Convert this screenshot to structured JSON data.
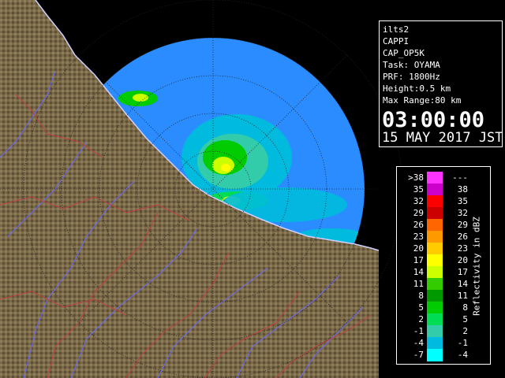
{
  "info": {
    "radar_name": "ilts2",
    "product": "CAPPI",
    "product_code": "CAP_OP5K",
    "task": "Task: OYAMA",
    "prf": "PRF: 1800Hz",
    "height": "Height:0.5 km",
    "max_range": "Max Range:80 km",
    "time": "03:00:00",
    "date": "15 MAY 2017 JST"
  },
  "legend": {
    "title": "Reflectivity in dBZ",
    "rows": [
      {
        "low": ">38",
        "high": "---",
        "color": "#ff33ff"
      },
      {
        "low": "35",
        "high": "38",
        "color": "#cc00cc"
      },
      {
        "low": "32",
        "high": "35",
        "color": "#ff0000"
      },
      {
        "low": "29",
        "high": "32",
        "color": "#cc0000"
      },
      {
        "low": "26",
        "high": "29",
        "color": "#ff6600"
      },
      {
        "low": "23",
        "high": "26",
        "color": "#ff9900"
      },
      {
        "low": "20",
        "high": "23",
        "color": "#ffcc00"
      },
      {
        "low": "17",
        "high": "20",
        "color": "#ffff00"
      },
      {
        "low": "14",
        "high": "17",
        "color": "#ccff00"
      },
      {
        "low": "11",
        "high": "14",
        "color": "#33cc00"
      },
      {
        "low": "8",
        "high": "11",
        "color": "#009900"
      },
      {
        "low": "5",
        "high": "8",
        "color": "#00cc00"
      },
      {
        "low": "2",
        "high": "5",
        "color": "#00dd55"
      },
      {
        "low": "-1",
        "high": "2",
        "color": "#33ccaa"
      },
      {
        "low": "-4",
        "high": "-1",
        "color": "#00bbdd"
      },
      {
        "low": "-7",
        "high": "-4",
        "color": "#00ffff"
      }
    ]
  },
  "colors": {
    "sea": "#000000",
    "coverage": "#2a8cff",
    "terrain": "#7a6a4a",
    "rivers": "#6a6aff",
    "borders": "#c04040"
  }
}
